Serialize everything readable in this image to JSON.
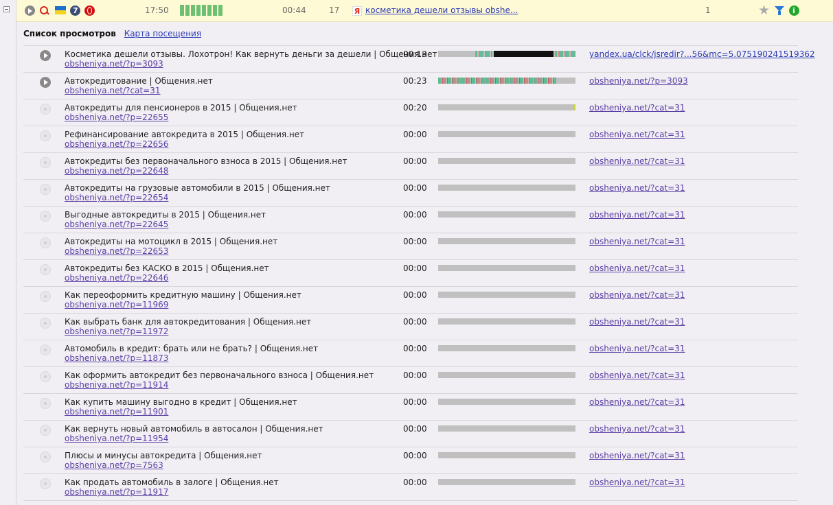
{
  "topbar": {
    "time": "17:50",
    "duration": "00:44",
    "pages": "17",
    "query": "косметика дешели отзывы obshe...",
    "visits": "1",
    "search_engine_icon": "Я"
  },
  "section": {
    "title": "Список просмотров",
    "map_link": "Карта посещения"
  },
  "rows": [
    {
      "title": "Косметика дешели отзывы. Лохотрон! Как вернуть деньги за дешели | Общения.нет",
      "url": "obsheniya.net/?p=3093",
      "duration": "00:13",
      "referrer": "yandex.ua/clck/jsredir?...56&mc=5.075190241519362",
      "playable": true
    },
    {
      "title": "Автокредитование | Общения.нет",
      "url": "obsheniya.net/?cat=31",
      "duration": "00:23",
      "referrer": "obsheniya.net/?p=3093",
      "playable": true
    },
    {
      "title": "Автокредиты для пенсионеров в 2015 | Общения.нет",
      "url": "obsheniya.net/?p=22655",
      "duration": "00:20",
      "referrer": "obsheniya.net/?cat=31",
      "playable": false
    },
    {
      "title": "Рефинансирование автокредита в 2015 | Общения.нет",
      "url": "obsheniya.net/?p=22656",
      "duration": "00:00",
      "referrer": "obsheniya.net/?cat=31",
      "playable": false
    },
    {
      "title": "Автокредиты без первоначального взноса в 2015 | Общения.нет",
      "url": "obsheniya.net/?p=22648",
      "duration": "00:00",
      "referrer": "obsheniya.net/?cat=31",
      "playable": false
    },
    {
      "title": "Автокредиты на грузовые автомобили в 2015 | Общения.нет",
      "url": "obsheniya.net/?p=22654",
      "duration": "00:00",
      "referrer": "obsheniya.net/?cat=31",
      "playable": false
    },
    {
      "title": "Выгодные автокредиты в 2015 | Общения.нет",
      "url": "obsheniya.net/?p=22645",
      "duration": "00:00",
      "referrer": "obsheniya.net/?cat=31",
      "playable": false
    },
    {
      "title": "Автокредиты на мотоцикл в 2015 | Общения.нет",
      "url": "obsheniya.net/?p=22653",
      "duration": "00:00",
      "referrer": "obsheniya.net/?cat=31",
      "playable": false
    },
    {
      "title": "Автокредиты без КАСКО в 2015 | Общения.нет",
      "url": "obsheniya.net/?p=22646",
      "duration": "00:00",
      "referrer": "obsheniya.net/?cat=31",
      "playable": false
    },
    {
      "title": "Как переоформить кредитную машину | Общения.нет",
      "url": "obsheniya.net/?p=11969",
      "duration": "00:00",
      "referrer": "obsheniya.net/?cat=31",
      "playable": false
    },
    {
      "title": "Как выбрать банк для автокредитования | Общения.нет",
      "url": "obsheniya.net/?p=11972",
      "duration": "00:00",
      "referrer": "obsheniya.net/?cat=31",
      "playable": false
    },
    {
      "title": "Автомобиль в кредит: брать или не брать? | Общения.нет",
      "url": "obsheniya.net/?p=11873",
      "duration": "00:00",
      "referrer": "obsheniya.net/?cat=31",
      "playable": false
    },
    {
      "title": "Как оформить автокредит без первоначального взноса | Общения.нет",
      "url": "obsheniya.net/?p=11914",
      "duration": "00:00",
      "referrer": "obsheniya.net/?cat=31",
      "playable": false
    },
    {
      "title": "Как купить машину выгодно в кредит | Общения.нет",
      "url": "obsheniya.net/?p=11901",
      "duration": "00:00",
      "referrer": "obsheniya.net/?cat=31",
      "playable": false
    },
    {
      "title": "Как вернуть новый автомобиль в автосалон | Общения.нет",
      "url": "obsheniya.net/?p=11954",
      "duration": "00:00",
      "referrer": "obsheniya.net/?cat=31",
      "playable": false
    },
    {
      "title": "Плюсы и минусы автокредита | Общения.нет",
      "url": "obsheniya.net/?p=7563",
      "duration": "00:00",
      "referrer": "obsheniya.net/?cat=31",
      "playable": false
    },
    {
      "title": "Как продать автомобиль в залоге | Общения.нет",
      "url": "obsheniya.net/?p=11917",
      "duration": "00:00",
      "referrer": "obsheniya.net/?cat=31",
      "playable": false
    }
  ]
}
